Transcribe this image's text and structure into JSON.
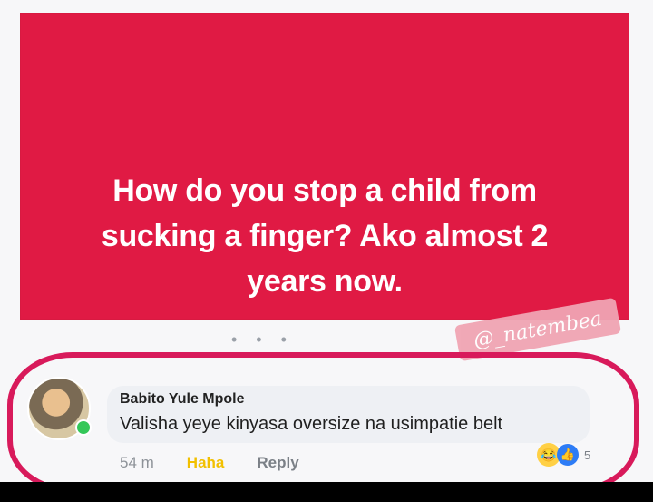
{
  "post": {
    "text": "How do you stop a child from sucking a finger? Ako almost 2 years now.",
    "background_color": "#e01a44"
  },
  "watermark": {
    "text": "@_natembea"
  },
  "comment": {
    "author": "Babito Yule Mpole",
    "text": "Valisha yeye kinyasa oversize na usimpatie belt",
    "time": "54 m",
    "reaction_label": "Haha",
    "reply_label": "Reply",
    "reaction_icons": [
      "laughing-face-icon",
      "thumbs-up-icon"
    ],
    "reaction_count": "5"
  },
  "colors": {
    "highlight": "#d81a5b",
    "online": "#34c759"
  }
}
